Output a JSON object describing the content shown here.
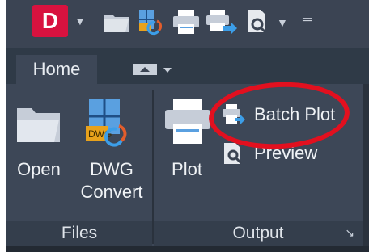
{
  "app": {
    "logo_letter": "D",
    "brand_color": "#d8123f"
  },
  "quick_access": {
    "icons": [
      "app-menu-caret-icon",
      "open-folder-icon",
      "dwg-convert-icon",
      "print-icon",
      "batch-plot-icon",
      "preview-icon",
      "customize-caret-icon"
    ]
  },
  "tabs": [
    {
      "label": "Home",
      "active": true
    }
  ],
  "ribbon": {
    "files_panel": {
      "title": "Files",
      "open_label": "Open",
      "dwg_label_line1": "DWG",
      "dwg_label_line2": "Convert",
      "dwg_badge": "DWG"
    },
    "output_panel": {
      "title": "Output",
      "plot_label": "Plot",
      "batch_plot_label": "Batch Plot",
      "preview_label": "Preview"
    }
  },
  "colors": {
    "toolbar_bg": "#3b4453",
    "ribbon_bg": "#3d4757",
    "highlight_ring": "#e2101f"
  }
}
